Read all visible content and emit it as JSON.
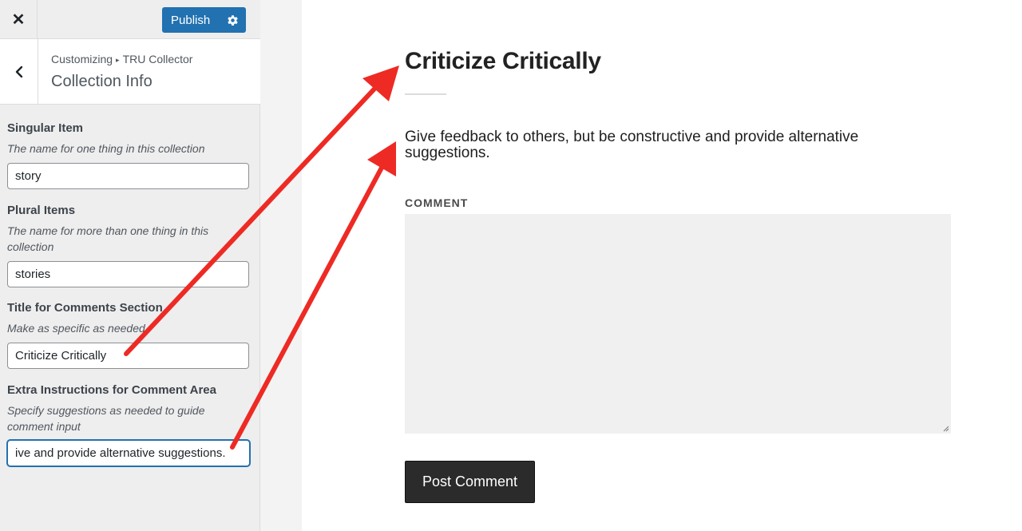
{
  "sidebar": {
    "publish_label": "Publish",
    "breadcrumb_root": "Customizing",
    "breadcrumb_sep": "▸",
    "breadcrumb_theme": "TRU Collector",
    "section_title": "Collection Info",
    "controls": [
      {
        "label": "Singular Item",
        "description": "The name for one thing in this collection",
        "value": "story"
      },
      {
        "label": "Plural Items",
        "description": "The name for more than one thing in this collection",
        "value": "stories"
      },
      {
        "label": "Title for Comments Section",
        "description": "Make as specific as needed",
        "value": "Criticize Critically"
      },
      {
        "label": "Extra Instructions for Comment Area",
        "description": "Specify suggestions as needed to guide comment input",
        "value": "ive and provide alternative suggestions."
      }
    ]
  },
  "preview": {
    "title": "Criticize Critically",
    "instructions": "Give feedback to others, but be constructive and provide alternative suggestions.",
    "comment_label": "COMMENT",
    "post_button": "Post Comment"
  },
  "colors": {
    "accent": "#2271b1",
    "arrow": "#ee2a24",
    "sidebar_bg": "#eeeeee"
  },
  "icons": {
    "close": "close-icon",
    "back": "chevron-left-icon",
    "settings": "gear-icon"
  }
}
